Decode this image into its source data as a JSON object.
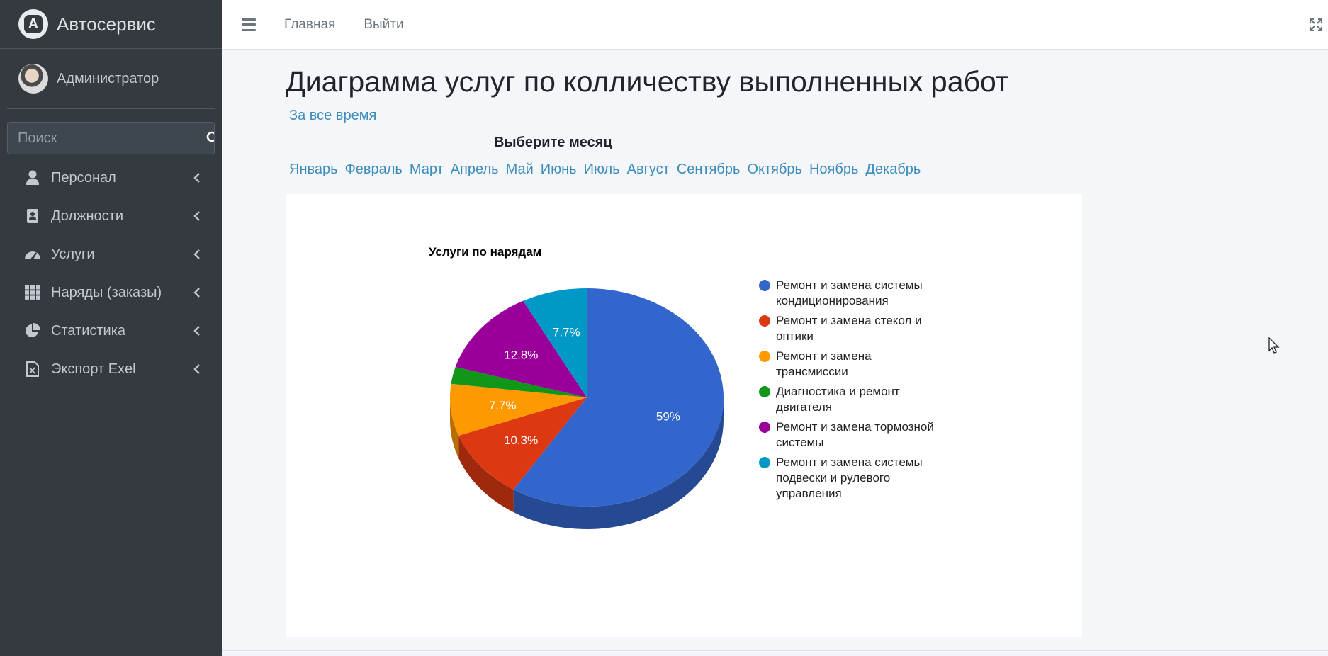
{
  "brand": {
    "name": "Автосервис"
  },
  "user": {
    "name": "Администратор"
  },
  "search": {
    "placeholder": "Поиск"
  },
  "sidebar": {
    "items": [
      {
        "label": "Персонал",
        "icon": "user-icon"
      },
      {
        "label": "Должности",
        "icon": "contact-book-icon"
      },
      {
        "label": "Услуги",
        "icon": "tachometer-icon"
      },
      {
        "label": "Наряды (заказы)",
        "icon": "grid-icon"
      },
      {
        "label": "Статистика",
        "icon": "pie-chart-icon"
      },
      {
        "label": "Экспорт Exel",
        "icon": "excel-file-icon"
      }
    ]
  },
  "header": {
    "home": "Главная",
    "logout": "Выйти"
  },
  "page": {
    "title": "Диаграмма услуг по колличеству выполненных работ",
    "all_time": "За все время",
    "month_heading": "Выберите месяц",
    "months": [
      "Январь",
      "Февраль",
      "Март",
      "Апрель",
      "Май",
      "Июнь",
      "Июль",
      "Август",
      "Сентябрь",
      "Октябрь",
      "Ноябрь",
      "Декабрь"
    ]
  },
  "chart_data": {
    "type": "pie",
    "is3D": true,
    "title": "Услуги по нарядам",
    "legend_position": "right",
    "slices": [
      {
        "label": "Ремонт и замена системы кондиционирования",
        "value": 59.0,
        "display": "59%",
        "color": "#3366cc"
      },
      {
        "label": "Ремонт и замена стекол и оптики",
        "value": 10.3,
        "display": "10.3%",
        "color": "#dc3912"
      },
      {
        "label": "Ремонт и замена трансмиссии",
        "value": 7.7,
        "display": "7.7%",
        "color": "#ff9900"
      },
      {
        "label": "Диагностика и ремонт двигателя",
        "value": 2.5,
        "display": "",
        "color": "#109618"
      },
      {
        "label": "Ремонт и замена тормозной системы",
        "value": 12.8,
        "display": "12.8%",
        "color": "#990099"
      },
      {
        "label": "Ремонт и замена системы подвески и рулевого управления",
        "value": 7.7,
        "display": "7.7%",
        "color": "#0099c6"
      }
    ]
  }
}
